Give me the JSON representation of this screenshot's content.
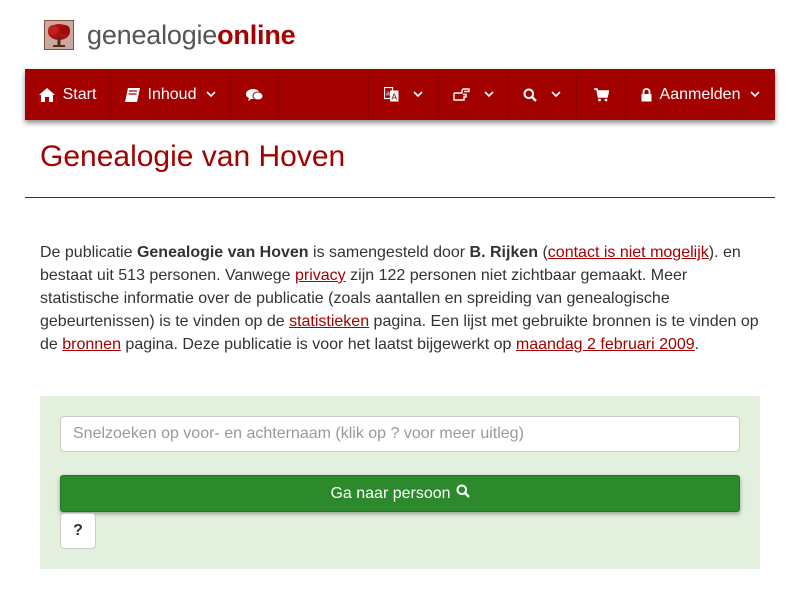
{
  "brand": {
    "part1": "genealogie",
    "part2": "online"
  },
  "nav": {
    "start": "Start",
    "inhoud": "Inhoud",
    "aanmelden": "Aanmelden"
  },
  "page": {
    "title": "Genealogie van Hoven"
  },
  "intro": {
    "t1": "De publicatie ",
    "pub_name": "Genealogie van Hoven",
    "t2": " is samengesteld door ",
    "author": "B. Rijken",
    "t3": " (",
    "contact_link": "contact is niet mogelijk",
    "t4": "). en bestaat uit 513 personen. Vanwege ",
    "privacy_link": "privacy",
    "t5": " zijn 122 personen niet zichtbaar gemaakt. Meer statistische informatie over de publicatie (zoals aantallen en spreiding van genealogische gebeurtenissen) is te vinden op de ",
    "stats_link": "statistieken",
    "t6": " pagina. Een lijst met gebruikte bronnen is te vinden op de ",
    "sources_link": "bronnen",
    "t7": " pagina. Deze publicatie is voor het laatst bijgewerkt op ",
    "date_link": "maandag 2 februari 2009",
    "t8": "."
  },
  "search": {
    "placeholder": "Snelzoeken op voor- en achternaam (klik op ? voor meer uitleg)",
    "button_label": "Ga naar persoon",
    "help_label": "?"
  },
  "colors": {
    "brand_red": "#a30000",
    "button_green": "#2c8a2c",
    "panel_green": "#e3f0de"
  },
  "icons": [
    "tree-logo",
    "home-icon",
    "book-icon",
    "comments-icon",
    "language-icon",
    "hand-point-icon",
    "search-icon",
    "cart-icon",
    "lock-icon",
    "chevron-down-icon"
  ]
}
